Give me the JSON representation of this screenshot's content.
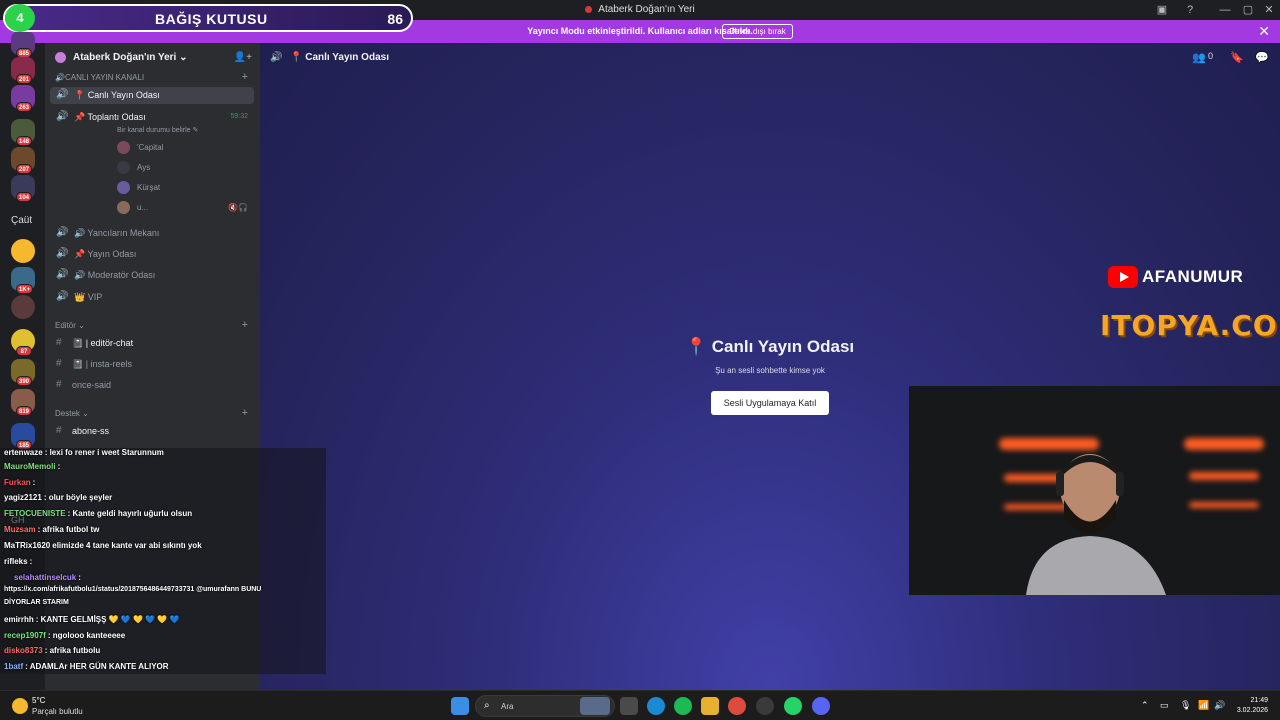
{
  "window": {
    "title": "Ataberk Doğan'ın Yeri"
  },
  "banner": {
    "message": "Yayıncı Modu etkinleştirildi. Kullanıcı adları kısaltıldı.",
    "button": "Devre dışı bırak",
    "close": "✕"
  },
  "donation": {
    "left_count": "4",
    "label": "BAĞIŞ KUTUSU",
    "right_count": "86"
  },
  "rail": {
    "badges": [
      "885",
      "201",
      "263",
      "148",
      "207",
      "104",
      "1K+",
      "87",
      "390",
      "819",
      "185"
    ],
    "text_item": "Çaüt",
    "text_item_gh": "GH"
  },
  "sidebar": {
    "server_name": "Ataberk Doğan'ın Yeri",
    "categories": {
      "live": "🔊CANLI YAYIN KANALI",
      "editor": "Editör",
      "support": "Destek"
    },
    "channels": {
      "live_room": "📍 Canlı Yayın Odası",
      "meeting": "📌 Toplantı Odası",
      "meeting_time": "59:32",
      "meeting_status": "Bir kanal durumu belirle ✎",
      "broadcasters": "🔊 Yancıların Mekanı",
      "stream": "📌 Yayın Odası",
      "moderators": "🔊 Moderatör Odası",
      "vip": "👑 VIP",
      "editor_chat": "📓 | editör-chat",
      "insta_reels": "📓 | insta-reels",
      "once_said": "once-said",
      "abone_ss": "abone-ss"
    },
    "voice_users": [
      "'Capital",
      "Ays",
      "Kürşat",
      "u..."
    ]
  },
  "chat": [
    {
      "user": "ertenwaze",
      "color": "#ffffff",
      "text": ": lexi fo rener i weet Starunnum"
    },
    {
      "user": "MauroMemoli",
      "color": "#7ee07e",
      "text": ":"
    },
    {
      "user": "Furkan",
      "color": "#ff5252",
      "text": ":"
    },
    {
      "user": "yagiz2121",
      "color": "#ffffff",
      "text": ": olur böyle şeyler"
    },
    {
      "user": "FETOCUENISTE",
      "color": "#7ee07e",
      "text": ": Kante geldi hayırlı uğurlu olsun"
    },
    {
      "user": "Muzsam",
      "color": "#ff6a6a",
      "text": ": afrika futbol tw"
    },
    {
      "user": "MaTRix1620",
      "color": "#ffffff",
      "text": "elimizde 4 tane kante var abi sıkıntı yok"
    },
    {
      "user": "rifleks",
      "color": "#ffffff",
      "text": ":"
    },
    {
      "user": "selahattinselcuk",
      "color": "#b38cff",
      "text": ":"
    },
    {
      "user": "",
      "color": "#ffffff",
      "text": "https://x.com/afrikafutbolu1/status/2018756486449733731 @umurafann BUNU"
    },
    {
      "user": "",
      "color": "#ffffff",
      "text": "DİYORLAR STARIM"
    },
    {
      "user": "emirrhh",
      "color": "#ffffff",
      "text": ": KANTE GELMİŞŞ 💛 💙 💛 💙 💛 💙"
    },
    {
      "user": "recep1907f",
      "color": "#7ee07e",
      "text": ": ngolooo kanteeeee"
    },
    {
      "user": "disko8373",
      "color": "#ff6a6a",
      "text": ": afrika futbolu"
    },
    {
      "user": "1batf",
      "color": "#8ab4ff",
      "text": ": ADAMLAr HER GÜN KANTE ALIYOR"
    }
  ],
  "main": {
    "header_title": "📍 Canlı Yayın Odası",
    "member_count": "0",
    "center_title": "📍 Canlı Yayın Odası",
    "center_sub": "Şu an sesli sohbette kimse yok",
    "join_button": "Sesli Uygulamaya Katıl"
  },
  "overlays": {
    "youtube_handle": "AFANUMUR",
    "sponsor": "ITOPYA.COM"
  },
  "taskbar": {
    "weather_temp": "5°C",
    "weather_desc": "Parçalı bulutlu",
    "search_placeholder": "Ara",
    "time": "21:49",
    "date": "3.02.2026"
  },
  "colors": {
    "accent_purple": "#a339e0",
    "sidebar": "#2b2d31",
    "rail": "#1e1f22",
    "online_green": "#23a55a",
    "badge_red": "#da373c"
  }
}
